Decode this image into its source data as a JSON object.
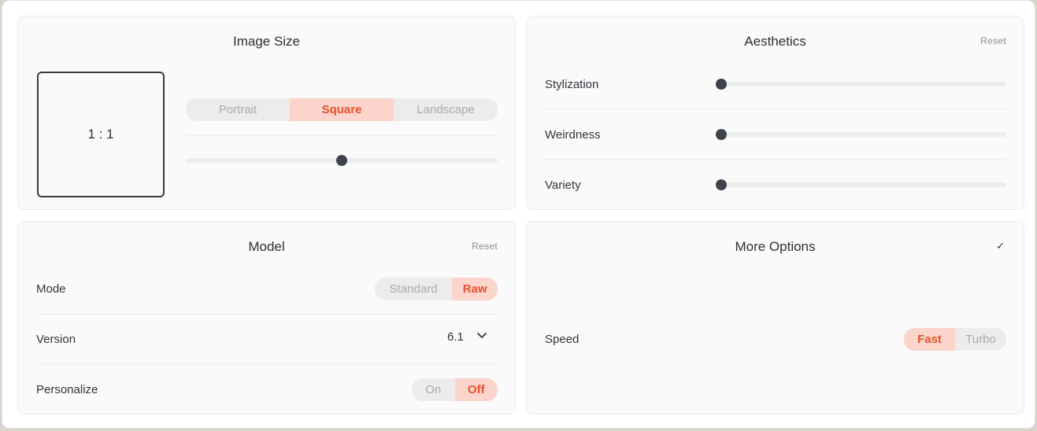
{
  "image_size": {
    "title": "Image Size",
    "ratio_label": "1 : 1",
    "orientation_options": [
      "Portrait",
      "Square",
      "Landscape"
    ],
    "selected_orientation": "Square",
    "aspect_slider_fraction": 0.5
  },
  "aesthetics": {
    "title": "Aesthetics",
    "reset_label": "Reset",
    "sliders": [
      {
        "label": "Stylization",
        "value_fraction": 0.0
      },
      {
        "label": "Weirdness",
        "value_fraction": 0.0
      },
      {
        "label": "Variety",
        "value_fraction": 0.0
      }
    ]
  },
  "model": {
    "title": "Model",
    "reset_label": "Reset",
    "mode_label": "Mode",
    "mode_options": [
      "Standard",
      "Raw"
    ],
    "selected_mode": "Raw",
    "version_label": "Version",
    "version_value": "6.1",
    "personalize_label": "Personalize",
    "personalize_options": [
      "On",
      "Off"
    ],
    "selected_personalize": "Off"
  },
  "more_options": {
    "title": "More Options",
    "check_glyph": "✓",
    "speed_label": "Speed",
    "speed_options": [
      "Fast",
      "Turbo"
    ],
    "selected_speed": "Fast"
  },
  "colors": {
    "accent_text": "#e5532f",
    "accent_bg": "#fbd4cc",
    "knob": "#3d424c"
  },
  "icons": {
    "version_dropdown": "chevron-down-icon",
    "more_options_toggle": "checkmark-icon"
  }
}
